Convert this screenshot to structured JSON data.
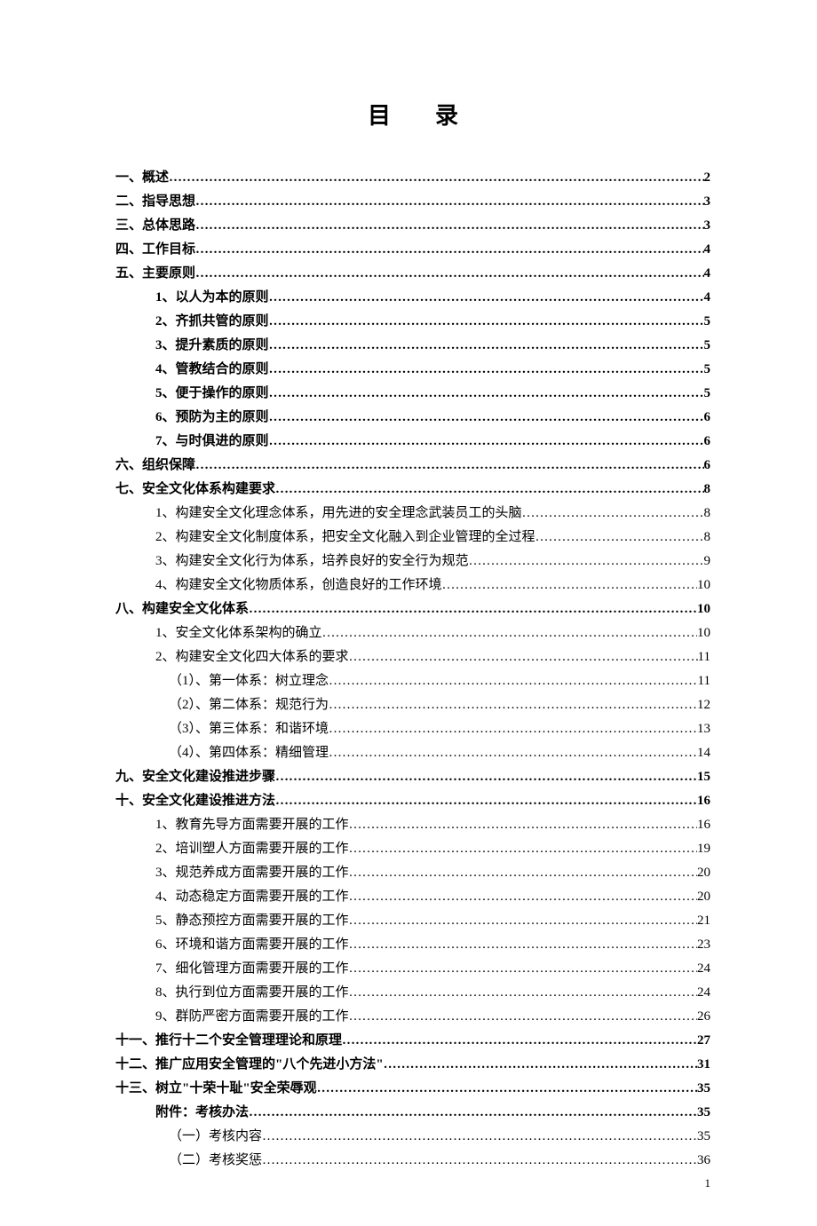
{
  "title": "目录",
  "page_number": "1",
  "entries": [
    {
      "level": "lvl1",
      "label": "一、概述",
      "page": "2"
    },
    {
      "level": "lvl1",
      "label": "二、指导思想",
      "page": "3"
    },
    {
      "level": "lvl1",
      "label": "三、总体思路",
      "page": "3"
    },
    {
      "level": "lvl1",
      "label": "四、工作目标",
      "page": "4"
    },
    {
      "level": "lvl1",
      "label": "五、主要原则",
      "page": "4"
    },
    {
      "level": "lvl2",
      "label": "1、以人为本的原则",
      "page": "4"
    },
    {
      "level": "lvl2",
      "label": "2、齐抓共管的原则",
      "page": "5"
    },
    {
      "level": "lvl2",
      "label": "3、提升素质的原则",
      "page": "5"
    },
    {
      "level": "lvl2",
      "label": "4、管教结合的原则",
      "page": "5"
    },
    {
      "level": "lvl2",
      "label": "5、便于操作的原则",
      "page": "5"
    },
    {
      "level": "lvl2",
      "label": "6、预防为主的原则",
      "page": "6"
    },
    {
      "level": "lvl2",
      "label": "7、与时俱进的原则",
      "page": "6"
    },
    {
      "level": "lvl1",
      "label": "六、组织保障",
      "page": "6"
    },
    {
      "level": "lvl1",
      "label": "七、安全文化体系构建要求",
      "page": "8"
    },
    {
      "level": "lvl2n",
      "label": "1、构建安全文化理念体系，用先进的安全理念武装员工的头脑",
      "page": "8"
    },
    {
      "level": "lvl2n",
      "label": "2、构建安全文化制度体系，把安全文化融入到企业管理的全过程",
      "page": "8"
    },
    {
      "level": "lvl2n",
      "label": "3、构建安全文化行为体系，培养良好的安全行为规范",
      "page": "9"
    },
    {
      "level": "lvl2n",
      "label": "4、构建安全文化物质体系，创造良好的工作环境",
      "page": "10"
    },
    {
      "level": "lvl1",
      "label": "八、构建安全文化体系",
      "page": "10"
    },
    {
      "level": "lvl2n",
      "label": "1、安全文化体系架构的确立",
      "page": "10"
    },
    {
      "level": "lvl2n",
      "label": "2、构建安全文化四大体系的要求",
      "page": "11"
    },
    {
      "level": "lvl3",
      "label": "（1）、第一体系：树立理念",
      "page": "11"
    },
    {
      "level": "lvl3",
      "label": "（2）、第二体系：规范行为",
      "page": "12"
    },
    {
      "level": "lvl3",
      "label": "（3）、第三体系：和谐环境",
      "page": "13"
    },
    {
      "level": "lvl3",
      "label": "（4）、第四体系：精细管理",
      "page": "14"
    },
    {
      "level": "lvl1",
      "label": "九、安全文化建设推进步骤",
      "page": "15"
    },
    {
      "level": "lvl1",
      "label": "十、安全文化建设推进方法",
      "page": "16"
    },
    {
      "level": "lvl2n",
      "label": "1、教育先导方面需要开展的工作",
      "page": "16"
    },
    {
      "level": "lvl2n",
      "label": "2、培训塑人方面需要开展的工作",
      "page": "19"
    },
    {
      "level": "lvl2n",
      "label": "3、规范养成方面需要开展的工作",
      "page": "20"
    },
    {
      "level": "lvl2n",
      "label": "4、动态稳定方面需要开展的工作",
      "page": "20"
    },
    {
      "level": "lvl2n",
      "label": "5、静态预控方面需要开展的工作",
      "page": "21"
    },
    {
      "level": "lvl2n",
      "label": "6、环境和谐方面需要开展的工作",
      "page": "23"
    },
    {
      "level": "lvl2n",
      "label": "7、细化管理方面需要开展的工作",
      "page": "24"
    },
    {
      "level": "lvl2n",
      "label": "8、执行到位方面需要开展的工作",
      "page": "24"
    },
    {
      "level": "lvl2n",
      "label": "9、群防严密方面需要开展的工作",
      "page": "26"
    },
    {
      "level": "lvl1",
      "label": "十一、推行十二个安全管理理论和原理",
      "page": "27"
    },
    {
      "level": "lvl1",
      "label": "十二、推广应用安全管理的\"八个先进小方法\"",
      "page": "31"
    },
    {
      "level": "lvl1",
      "label": "十三、树立\"十荣十耻\"安全荣辱观",
      "page": "35"
    },
    {
      "level": "lvl2",
      "label": "附件：考核办法",
      "page": "35"
    },
    {
      "level": "lvl3",
      "label": "（一）考核内容",
      "page": "35"
    },
    {
      "level": "lvl3",
      "label": "（二）考核奖惩",
      "page": "36"
    }
  ]
}
